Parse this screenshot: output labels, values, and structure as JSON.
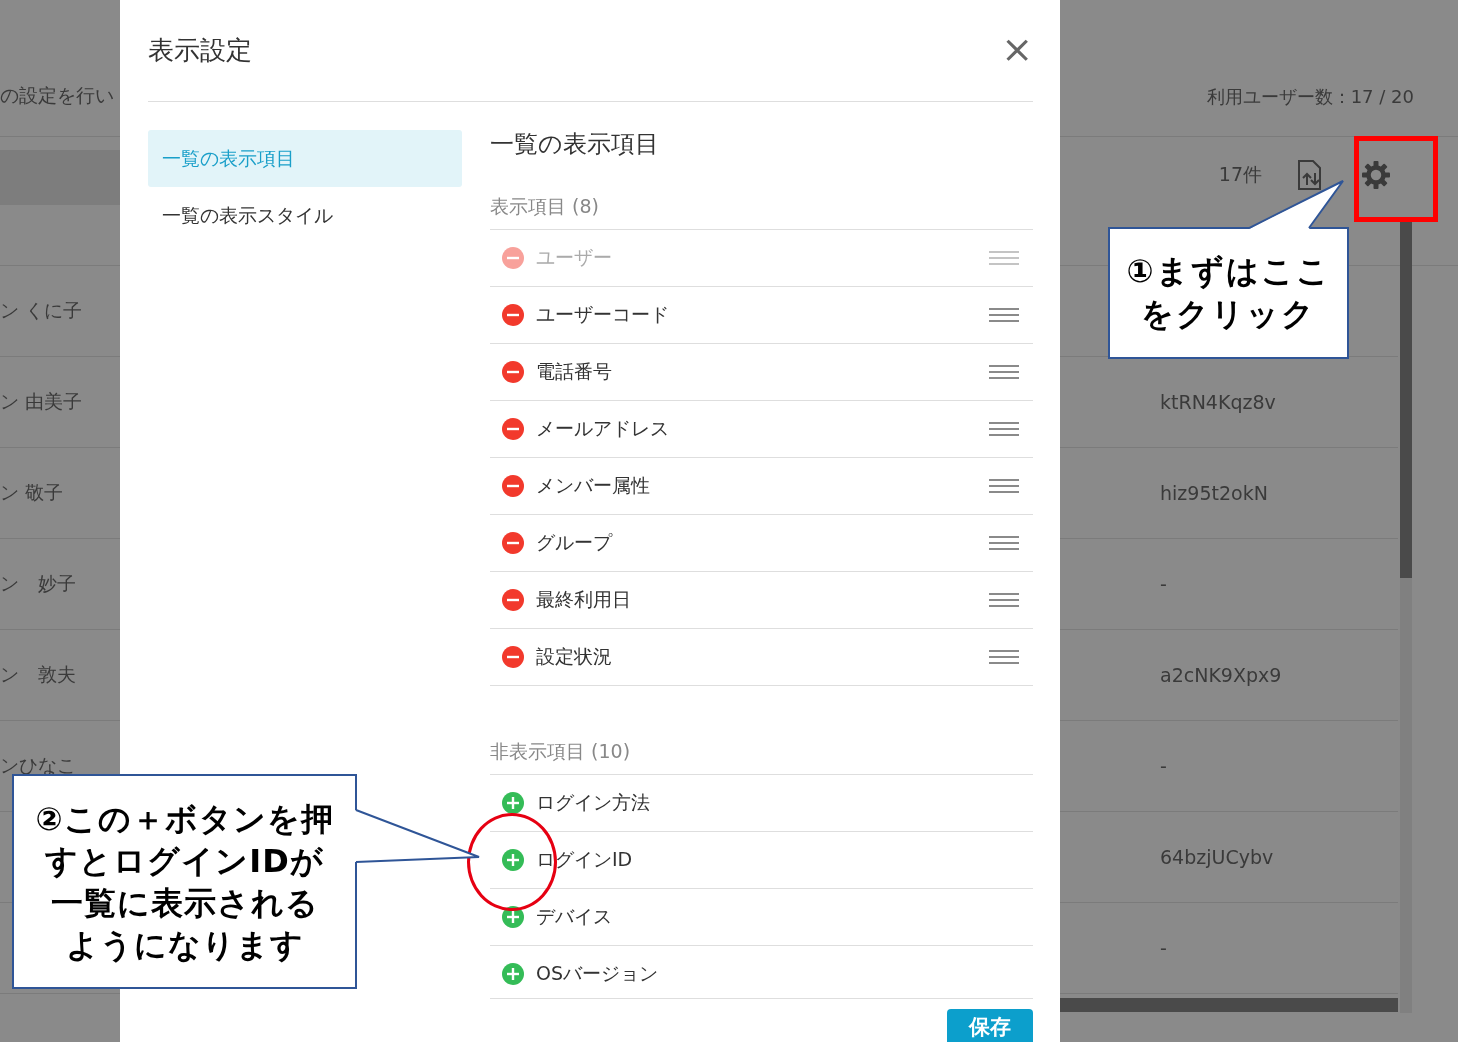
{
  "background": {
    "notice": "の設定を行い",
    "user_count": "利用ユーザー数：17 / 20",
    "result_count": "17件",
    "rows": [
      {
        "name": "ン くに子"
      },
      {
        "name": "ン 由美子",
        "code": "ktRN4Kqz8v"
      },
      {
        "name": "ン 敬子",
        "code": "hiz95t2okN"
      },
      {
        "name": "ン　妙子",
        "code": "-"
      },
      {
        "name": "ン　敦夫",
        "code": "a2cNK9Xpx9"
      },
      {
        "name": "ンひなこ",
        "code": "-"
      },
      {
        "code": "64bzjUCybv"
      },
      {
        "code": "-"
      }
    ]
  },
  "dialog": {
    "title": "表示設定",
    "close": "×",
    "nav": [
      {
        "label": "一覧の表示項目",
        "selected": true
      },
      {
        "label": "一覧の表示スタイル",
        "selected": false
      }
    ],
    "heading": "一覧の表示項目",
    "shown": {
      "label": "表示項目 (8)",
      "items": [
        {
          "label": "ユーザー",
          "disabled": true
        },
        {
          "label": "ユーザーコード",
          "disabled": false
        },
        {
          "label": "電話番号",
          "disabled": false
        },
        {
          "label": "メールアドレス",
          "disabled": false
        },
        {
          "label": "メンバー属性",
          "disabled": false
        },
        {
          "label": "グループ",
          "disabled": false
        },
        {
          "label": "最終利用日",
          "disabled": false
        },
        {
          "label": "設定状況",
          "disabled": false
        }
      ]
    },
    "hidden": {
      "label": "非表示項目 (10)",
      "items": [
        {
          "label": "ログイン方法"
        },
        {
          "label": "ログインID"
        },
        {
          "label": "デバイス"
        },
        {
          "label": "OSバージョン"
        }
      ]
    },
    "save_button": "保存"
  },
  "callouts": [
    {
      "lines": [
        "①まずはここ",
        "をクリック"
      ]
    },
    {
      "lines": [
        "②この＋ボタンを押",
        "すとログインIDが",
        "一覧に表示される",
        "ようになります"
      ]
    }
  ]
}
